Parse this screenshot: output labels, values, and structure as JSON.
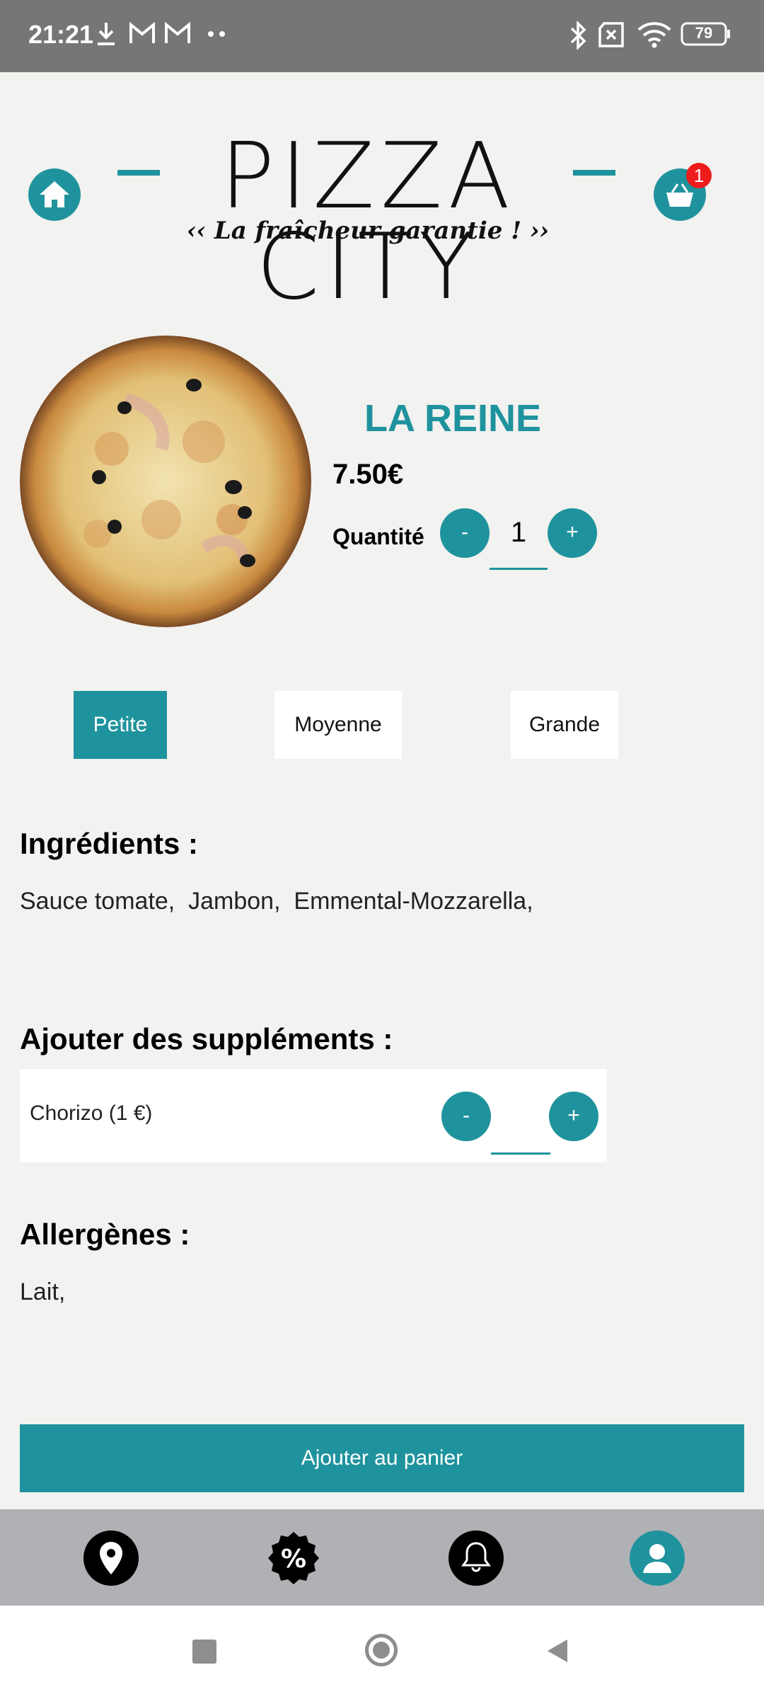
{
  "status_bar": {
    "time": "21:21",
    "battery": "79",
    "icons": [
      "download-icon",
      "gmail-icon",
      "gmail-icon",
      "more-dots-icon",
      "bluetooth-icon",
      "no-sim-icon",
      "wifi-icon",
      "battery-icon"
    ]
  },
  "header": {
    "logo_title": "PIZZA CITY",
    "logo_tagline": "‹‹ La fraîcheur garantie ! ››",
    "cart_count": "1"
  },
  "product": {
    "name": "LA REINE",
    "price": "7.50€",
    "quantity_label": "Quantité",
    "quantity_value": "1",
    "minus_label": "-",
    "plus_label": "+"
  },
  "sizes": [
    {
      "label": "Petite",
      "selected": true
    },
    {
      "label": "Moyenne",
      "selected": false
    },
    {
      "label": "Grande",
      "selected": false
    }
  ],
  "ingredients": {
    "title": "Ingrédients :",
    "text": "Sauce tomate,  Jambon,  Emmental-Mozzarella,"
  },
  "supplements": {
    "title": "Ajouter des suppléments :",
    "items": [
      {
        "label": "Chorizo (1 €)",
        "value": "",
        "minus": "-",
        "plus": "+"
      }
    ]
  },
  "allergens": {
    "title": "Allergènes :",
    "text": "Lait,"
  },
  "cta": {
    "label": "Ajouter au panier"
  },
  "bottom_nav": [
    "location-icon",
    "discount-icon",
    "bell-icon",
    "user-icon"
  ],
  "colors": {
    "accent": "#1f939d",
    "badge": "#ee1c1c",
    "status_bar": "#767578",
    "nav": "#b0b1b5"
  }
}
